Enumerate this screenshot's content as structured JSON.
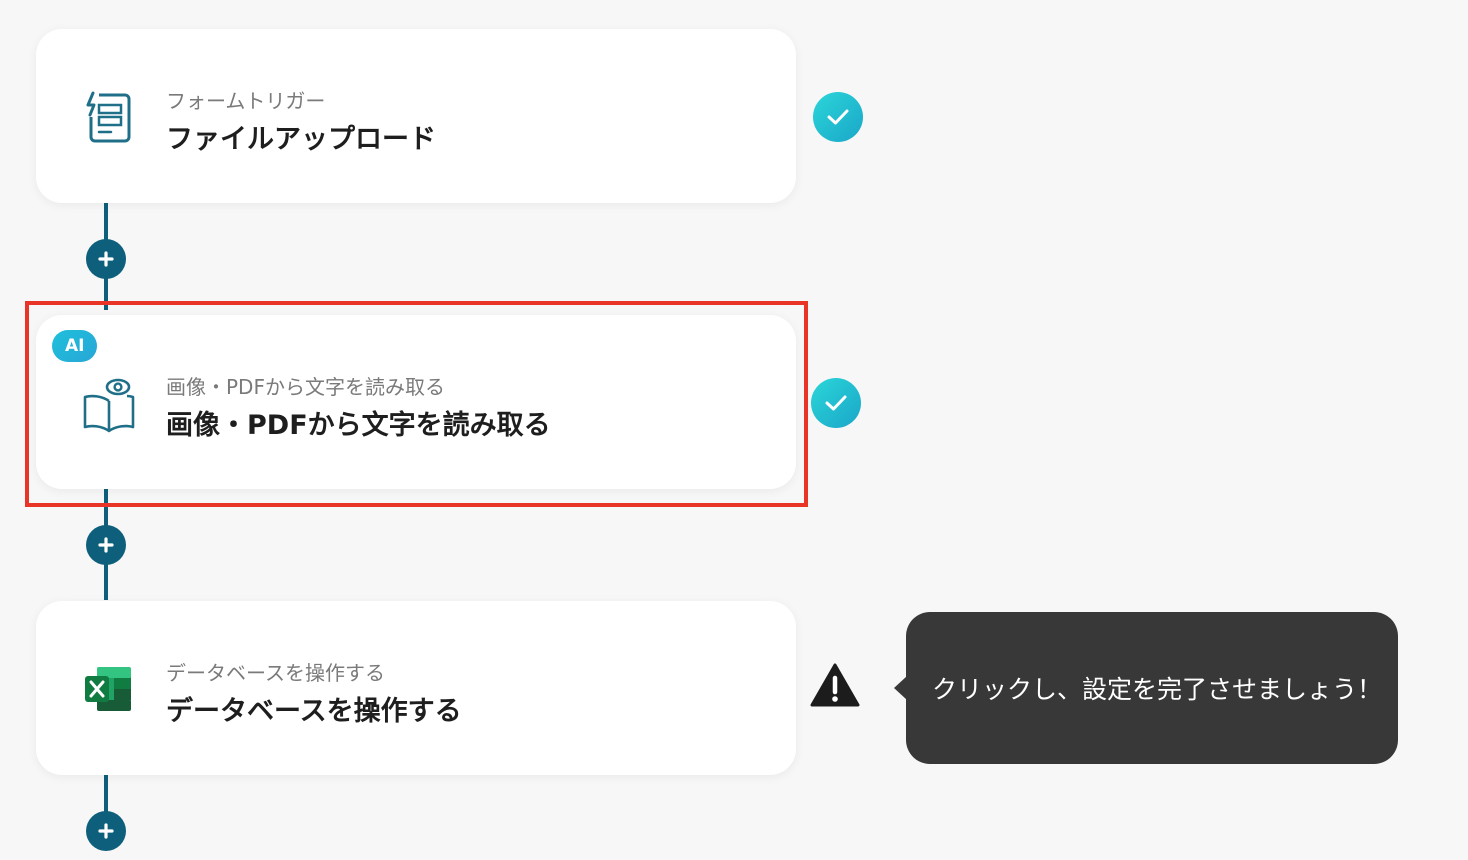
{
  "flow": {
    "steps": [
      {
        "subtitle": "フォームトリガー",
        "title": "ファイルアップロード",
        "icon": "form-trigger-icon",
        "status": "complete"
      },
      {
        "badge": "AI",
        "subtitle": "画像・PDFから文字を読み取る",
        "title": "画像・PDFから文字を読み取る",
        "icon": "ocr-book-eye-icon",
        "status": "complete",
        "highlighted": true
      },
      {
        "subtitle": "データベースを操作する",
        "title": "データベースを操作する",
        "icon": "excel-icon",
        "status": "warning"
      }
    ]
  },
  "tooltip": {
    "text": "クリックし、設定を完了させましょう！"
  },
  "colors": {
    "connector": "#0e5f7b",
    "check_gradient_start": "#2bd6d9",
    "check_gradient_end": "#1aa6c8",
    "highlight_border": "#e83527",
    "tooltip_bg": "#383838",
    "excel_green": "#1d7044"
  }
}
